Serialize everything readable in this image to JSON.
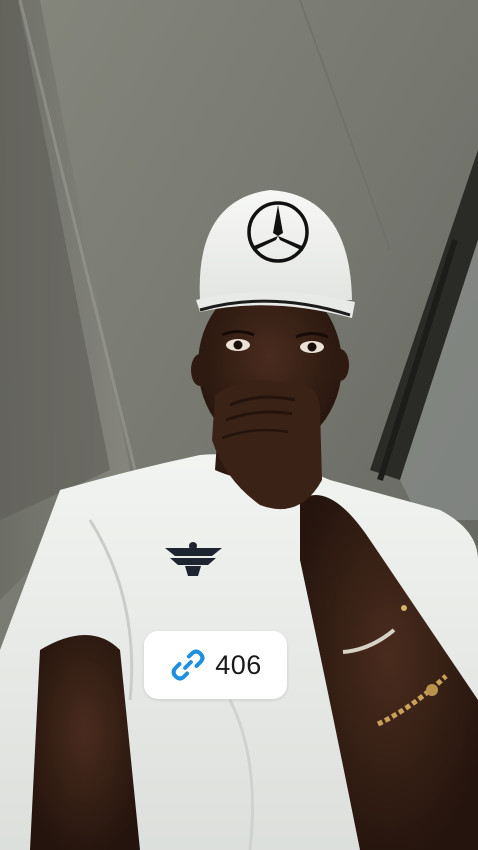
{
  "story": {
    "photo_alt": "",
    "link_sticker": {
      "icon": "link-icon",
      "count": "406",
      "icon_color": "#1f8fe0"
    }
  }
}
